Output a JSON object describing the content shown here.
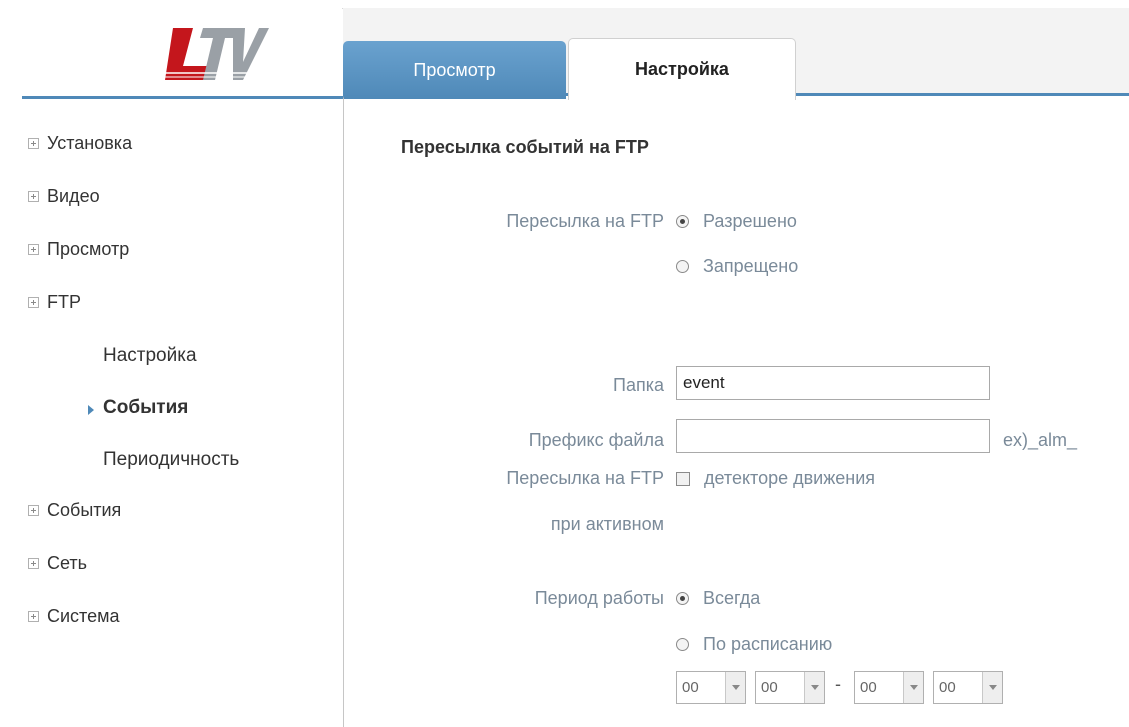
{
  "brand": {
    "logo_text": "LTV",
    "logo_colors": [
      "#c4161c",
      "#9aa0a6"
    ]
  },
  "tabs": [
    {
      "label": "Просмотр",
      "active": false
    },
    {
      "label": "Настройка",
      "active": true
    }
  ],
  "sidebar": {
    "items": [
      {
        "label": "Установка"
      },
      {
        "label": "Видео"
      },
      {
        "label": "Просмотр"
      },
      {
        "label": "FTP"
      },
      {
        "label": "События"
      },
      {
        "label": "Сеть"
      },
      {
        "label": "Система"
      }
    ],
    "ftp_subitems": [
      {
        "label": "Настройка",
        "active": false
      },
      {
        "label": "События",
        "active": true
      },
      {
        "label": "Периодичность",
        "active": false
      }
    ]
  },
  "main": {
    "section_title": "Пересылка событий на FTP",
    "ftp_upload": {
      "label": "Пересылка на FTP",
      "options": [
        {
          "label": "Разрешено",
          "selected": true
        },
        {
          "label": "Запрещено",
          "selected": false
        }
      ]
    },
    "folder": {
      "label": "Папка",
      "value": "event"
    },
    "file_prefix": {
      "label": "Префикс файла",
      "value": "",
      "hint": "ex)_alm_"
    },
    "upload_trigger": {
      "label_line1": "Пересылка на FTP",
      "label_line2": "при активном",
      "checkbox_label": "детекторе движения",
      "checked": false
    },
    "work_period": {
      "label": "Период работы",
      "options": [
        {
          "label": "Всегда",
          "selected": true
        },
        {
          "label": "По расписанию",
          "selected": false
        }
      ],
      "time_start": [
        "00",
        "00"
      ],
      "time_end": [
        "00",
        "00"
      ],
      "separator": "-"
    }
  },
  "colors": {
    "accent": "#4f89b8",
    "label": "#7a8a99"
  }
}
